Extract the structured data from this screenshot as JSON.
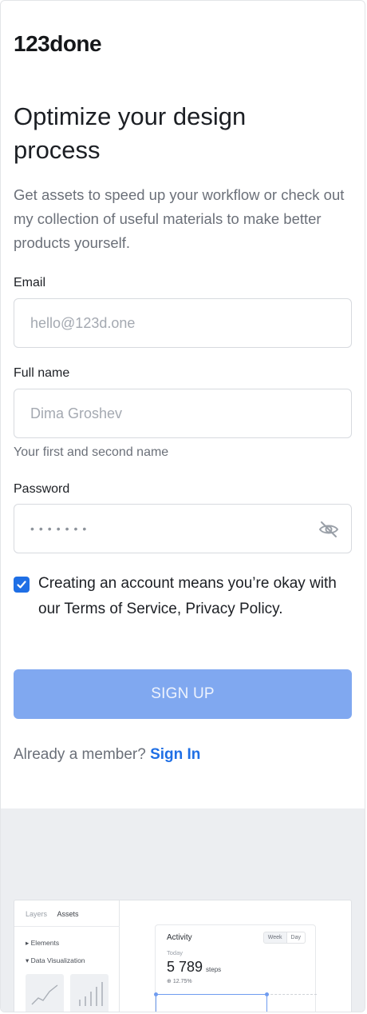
{
  "logo": "123done",
  "headline": "Optimize your design process",
  "subtext": "Get assets to speed up your workflow or check out my collection of useful materials to make better products yourself.",
  "form": {
    "email_label": "Email",
    "email_placeholder": "hello@123d.one",
    "name_label": "Full name",
    "name_placeholder": "Dima Groshev",
    "name_helper": "Your first and second name",
    "password_label": "Password",
    "password_mask": "•••••••",
    "consent_checked": true,
    "consent_text": "Creating an account means you’re okay with our Terms of Service, Privacy Policy.",
    "submit_label": "SIGN UP"
  },
  "footer": {
    "already_text": "Already a member?",
    "sign_in_label": "Sign In"
  },
  "preview": {
    "tabs": [
      "Layers",
      "Assets"
    ],
    "items": [
      "Elements",
      "Data Visualization"
    ],
    "card_title": "Activity",
    "toggle": [
      "Week",
      "Day"
    ],
    "card_sub": "Today",
    "card_value": "5 789",
    "card_unit": "steps",
    "card_change": "12.75%"
  },
  "colors": {
    "accent": "#1f6fe5",
    "button_disabled": "#80a8f0",
    "band": "#eceef1"
  }
}
